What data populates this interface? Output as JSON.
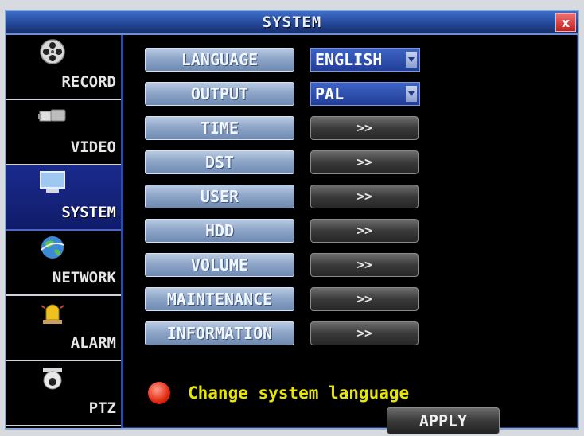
{
  "window": {
    "title": "SYSTEM",
    "close_label": "x"
  },
  "sidebar": {
    "items": [
      {
        "label": "RECORD",
        "icon": "film-reel-icon"
      },
      {
        "label": "VIDEO",
        "icon": "camera-icon"
      },
      {
        "label": "SYSTEM",
        "icon": "monitor-icon",
        "active": true
      },
      {
        "label": "NETWORK",
        "icon": "globe-icon"
      },
      {
        "label": "ALARM",
        "icon": "alarm-light-icon"
      },
      {
        "label": "PTZ",
        "icon": "dome-camera-icon"
      }
    ]
  },
  "settings": {
    "language": {
      "label": "LANGUAGE",
      "value": "ENGLISH"
    },
    "output": {
      "label": "OUTPUT",
      "value": "PAL"
    },
    "time": {
      "label": "TIME",
      "action": ">>"
    },
    "dst": {
      "label": "DST",
      "action": ">>"
    },
    "user": {
      "label": "USER",
      "action": ">>"
    },
    "hdd": {
      "label": "HDD",
      "action": ">>"
    },
    "volume": {
      "label": "VOLUME",
      "action": ">>"
    },
    "maintenance": {
      "label": "MAINTENANCE",
      "action": ">>"
    },
    "information": {
      "label": "INFORMATION",
      "action": ">>"
    }
  },
  "status": {
    "text": "Change system language"
  },
  "apply_label": "APPLY",
  "colors": {
    "accent": "#2b4fa4",
    "status_text": "#e6e600",
    "status_dot": "#e02a10"
  }
}
